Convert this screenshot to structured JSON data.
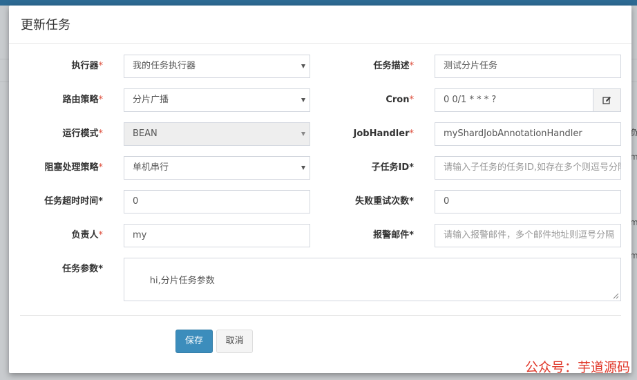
{
  "modal": {
    "title": "更新任务",
    "fields": {
      "executor": {
        "label": "执行器",
        "value": "我的任务执行器"
      },
      "job_desc": {
        "label": "任务描述",
        "value": "测试分片任务"
      },
      "route_strategy": {
        "label": "路由策略",
        "value": "分片广播"
      },
      "cron": {
        "label": "Cron",
        "value": "0 0/1 * * * ?"
      },
      "run_mode": {
        "label": "运行模式",
        "value": "BEAN"
      },
      "job_handler": {
        "label": "JobHandler",
        "value": "myShardJobAnnotationHandler"
      },
      "block_strategy": {
        "label": "阻塞处理策略",
        "value": "单机串行"
      },
      "child_job_id": {
        "label": "子任务ID",
        "placeholder": "请输入子任务的任务ID,如存在多个则逗号分隔"
      },
      "timeout": {
        "label": "任务超时时间",
        "value": "0"
      },
      "retry_count": {
        "label": "失败重试次数",
        "value": "0"
      },
      "author": {
        "label": "负责人",
        "value": "my"
      },
      "alarm_email": {
        "label": "报警邮件",
        "placeholder": "请输入报警邮件，多个邮件地址则逗号分隔"
      },
      "job_param": {
        "label": "任务参数",
        "value": "hi,分片任务参数"
      }
    },
    "required_mark": "*",
    "buttons": {
      "save": "保存",
      "cancel": "取消"
    }
  },
  "background": {
    "right_edge_glyphs": [
      "负",
      "m",
      "m",
      "m"
    ]
  },
  "watermark": "公众号：芋道源码",
  "colors": {
    "primary": "#3c8dbc",
    "required": "#dd4b39",
    "topbar": "#2d6a93"
  },
  "icons": {
    "cron_addon": "edit-icon"
  }
}
